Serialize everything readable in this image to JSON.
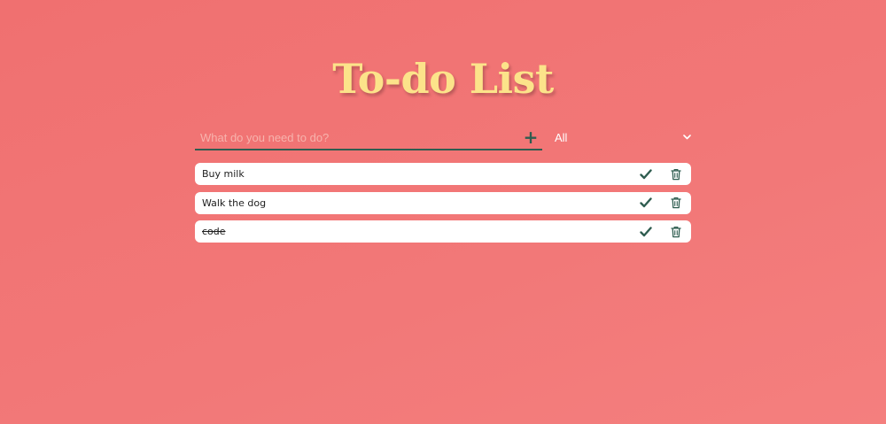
{
  "header": {
    "title": "To-do List"
  },
  "form": {
    "placeholder": "What do you need to do?",
    "value": "",
    "add_label": "+"
  },
  "filter": {
    "selected": "All"
  },
  "todos": [
    {
      "text": "Buy milk",
      "completed": false
    },
    {
      "text": "Walk the dog",
      "completed": false
    },
    {
      "text": "code",
      "completed": true
    }
  ],
  "icons": {
    "add": "plus-icon",
    "dropdown": "chevron-down-icon",
    "complete": "check-icon",
    "delete": "trash-icon"
  },
  "colors": {
    "background": "#f07272",
    "title": "#fce38a",
    "accent": "#2f5d50",
    "item_background": "#ffffff"
  }
}
